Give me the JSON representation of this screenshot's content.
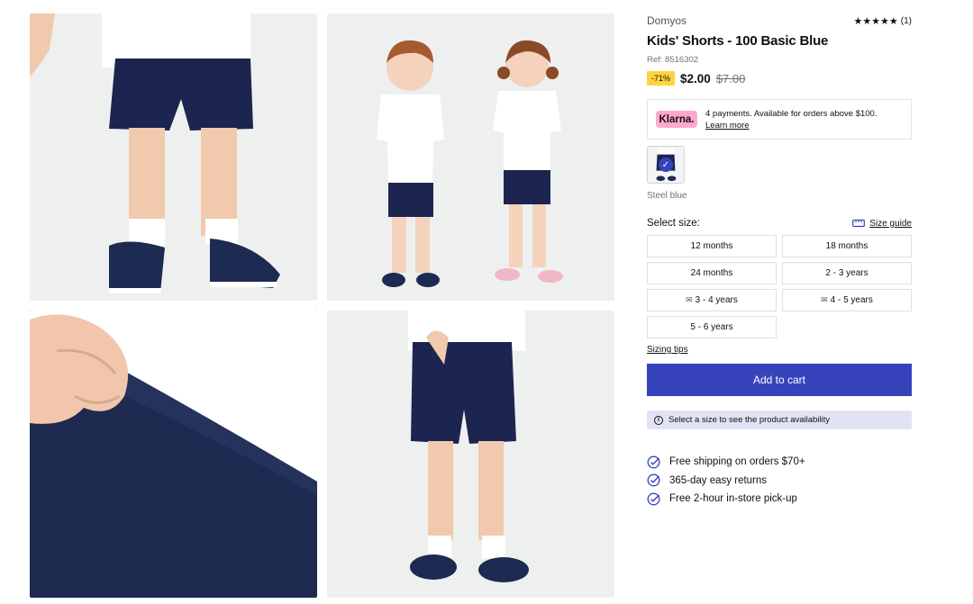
{
  "product": {
    "brand": "Domyos",
    "rating_stars": "★★★★★",
    "rating_count": "(1)",
    "title": "Kids' Shorts - 100 Basic Blue",
    "ref": "Ref: 8516302",
    "discount": "-71%",
    "price": "$2.00",
    "old_price": "$7.00"
  },
  "klarna": {
    "logo": "Klarna.",
    "text": "4 payments. Available for orders above $100.",
    "link": "Learn more"
  },
  "color": {
    "name": "Steel blue",
    "check_icon": "✓"
  },
  "sizes": {
    "label": "Select size:",
    "guide_label": "Size guide",
    "options": [
      {
        "label": "12 months",
        "notify": false
      },
      {
        "label": "18 months",
        "notify": false
      },
      {
        "label": "24 months",
        "notify": false
      },
      {
        "label": "2 - 3 years",
        "notify": false
      },
      {
        "label": "3 - 4 years",
        "notify": true
      },
      {
        "label": "4 - 5 years",
        "notify": true
      },
      {
        "label": "5 - 6 years",
        "notify": false
      }
    ],
    "tips": "Sizing tips"
  },
  "cart": {
    "add_label": "Add to cart",
    "availability": "Select a size to see the product availability"
  },
  "benefits": [
    "Free shipping on orders $70+",
    "365-day easy returns",
    "Free 2-hour in-store pick-up"
  ],
  "colors": {
    "accent": "#3643ba",
    "discount": "#ffd33d",
    "klarna": "#ffa8cd"
  }
}
